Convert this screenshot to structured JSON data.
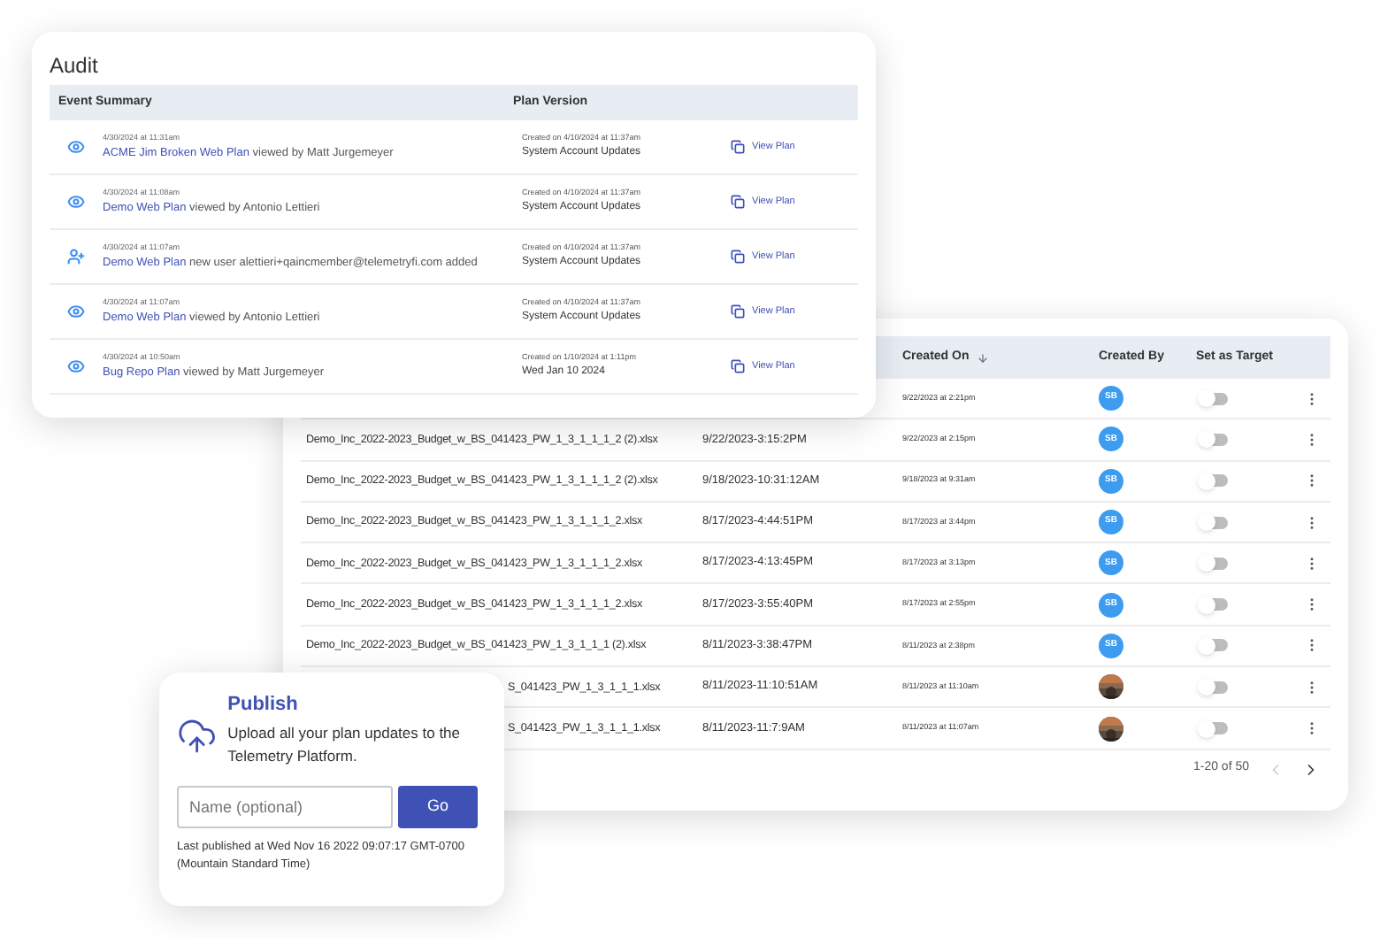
{
  "files": {
    "columns": [
      {
        "label": "Created On",
        "sorted": true
      },
      {
        "label": "Created By",
        "sorted": false
      },
      {
        "label": "Set as Target",
        "sorted": false
      }
    ],
    "rows": [
      {
        "kind": "hidden",
        "created_on": "9/22/2023 at 2:21pm",
        "avatar": {
          "kind": "initials",
          "initials": "SB"
        },
        "on": false
      },
      {
        "kind": "full",
        "name": "Demo_Inc_2022-2023_Budget_w_BS_041423_PW_1_3_1_1_1_2 (2).xlsx",
        "modified": "9/22/2023-3:15:2PM",
        "created_on": "9/22/2023 at 2:15pm",
        "avatar": {
          "kind": "initials",
          "initials": "SB"
        },
        "on": false
      },
      {
        "kind": "full",
        "name": "Demo_Inc_2022-2023_Budget_w_BS_041423_PW_1_3_1_1_1_2 (2).xlsx",
        "modified": "9/18/2023-10:31:12AM",
        "created_on": "9/18/2023 at 9:31am",
        "avatar": {
          "kind": "initials",
          "initials": "SB"
        },
        "on": false
      },
      {
        "kind": "full",
        "name": "Demo_Inc_2022-2023_Budget_w_BS_041423_PW_1_3_1_1_1_2.xlsx",
        "modified": "8/17/2023-4:44:51PM",
        "created_on": "8/17/2023 at 3:44pm",
        "avatar": {
          "kind": "initials",
          "initials": "SB"
        },
        "on": false
      },
      {
        "kind": "full",
        "name": "Demo_Inc_2022-2023_Budget_w_BS_041423_PW_1_3_1_1_1_2.xlsx",
        "modified": "8/17/2023-4:13:45PM",
        "created_on": "8/17/2023 at 3:13pm",
        "avatar": {
          "kind": "initials",
          "initials": "SB"
        },
        "on": false
      },
      {
        "kind": "full",
        "name": "Demo_Inc_2022-2023_Budget_w_BS_041423_PW_1_3_1_1_1_2.xlsx",
        "modified": "8/17/2023-3:55:40PM",
        "created_on": "8/17/2023 at 2:55pm",
        "avatar": {
          "kind": "initials",
          "initials": "SB"
        },
        "on": false
      },
      {
        "kind": "full",
        "name": "Demo_Inc_2022-2023_Budget_w_BS_041423_PW_1_3_1_1_1 (2).xlsx",
        "modified": "8/11/2023-3:38:47PM",
        "created_on": "8/11/2023 at 2:38pm",
        "avatar": {
          "kind": "initials",
          "initials": "SB"
        },
        "on": false
      },
      {
        "kind": "partial",
        "name": "S_041423_PW_1_3_1_1_1.xlsx",
        "modified": "8/11/2023-11:10:51AM",
        "created_on": "8/11/2023 at 11:10am",
        "on": false
      },
      {
        "kind": "partial",
        "name": "S_041423_PW_1_3_1_1_1.xlsx",
        "modified": "8/11/2023-11:7:9AM",
        "created_on": "8/11/2023 at 11:07am",
        "on": false
      }
    ],
    "pagination": {
      "range": "1-20 of 50",
      "prev_disabled": true,
      "next_disabled": false
    }
  },
  "audit": {
    "title": "Audit",
    "columns": [
      "Event Summary",
      "Plan Version"
    ],
    "rows": [
      {
        "kind": "view",
        "time": "4/30/2024 at 11:31am",
        "link": "ACME Jim Broken Web Plan",
        "text": "viewed by Matt Jurgemeyer",
        "created": "Created on 4/10/2024 at 11:37am",
        "version": "System Account Updates",
        "action": "View Plan"
      },
      {
        "kind": "view",
        "time": "4/30/2024 at 11:08am",
        "link": "Demo Web Plan",
        "text": "viewed by Antonio Lettieri",
        "created": "Created on 4/10/2024 at 11:37am",
        "version": "System Account Updates",
        "action": "View Plan"
      },
      {
        "kind": "add_user",
        "time": "4/30/2024 at 11:07am",
        "link": "Demo Web Plan",
        "text": "new user alettieri+qaincmember@telemetryfi.com added",
        "created": "Created on 4/10/2024 at 11:37am",
        "version": "System Account Updates",
        "action": "View Plan"
      },
      {
        "kind": "view",
        "time": "4/30/2024 at 11:07am",
        "link": "Demo Web Plan",
        "text": "viewed by Antonio Lettieri",
        "created": "Created on 4/10/2024 at 11:37am",
        "version": "System Account Updates",
        "action": "View Plan"
      },
      {
        "kind": "view",
        "time": "4/30/2024 at 10:50am",
        "link": "Bug Repo Plan",
        "text": "viewed by Matt Jurgemeyer",
        "created": "Created on 1/10/2024 at 1:11pm",
        "version": "Wed Jan 10 2024",
        "action": "View Plan"
      }
    ]
  },
  "publish": {
    "title": "Publish",
    "description": "Upload all your plan updates to the Telemetry Platform.",
    "placeholder": "Name (optional)",
    "button": "Go",
    "last_published": "Last published at Wed Nov 16 2022 09:07:17 GMT-0700 (Mountain Standard Time)"
  }
}
